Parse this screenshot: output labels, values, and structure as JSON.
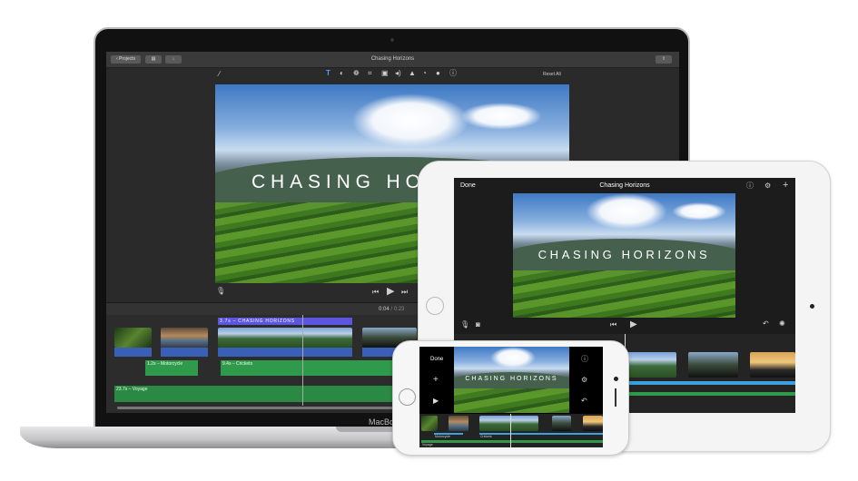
{
  "mac": {
    "brand": "MacBook",
    "toolbar": {
      "projects_label": "Projects",
      "title": "Chasing Horizons",
      "reset_label": "Reset All"
    },
    "tools": [
      "magic-wand-icon",
      "title-T-icon",
      "color-balance-icon",
      "color-correction-icon",
      "crop-icon",
      "stabilization-icon",
      "volume-icon",
      "noise-reduction-icon",
      "speed-icon",
      "filter-icon",
      "info-icon"
    ],
    "video_title": "CHASING HO",
    "time": {
      "current": "0:04",
      "total": "0:23"
    },
    "timeline": {
      "title_clip": "3.7s – CHASING HORIZONS",
      "audio": [
        "1.2s – Motorcycle",
        "9.4s – Crickets"
      ],
      "music": "23.7s – Voyage"
    }
  },
  "ipad": {
    "done_label": "Done",
    "title": "Chasing Horizons",
    "video_title": "CHASING HORIZONS"
  },
  "iphone": {
    "done_label": "Done",
    "video_title": "CHASING HORIZONS",
    "audio": [
      "Motorcycle",
      "Crickets"
    ],
    "music": "Voyage"
  },
  "colors": {
    "title_clip": "#5b55e0",
    "audio_clip": "#2f9a4c",
    "video_track": "#3a5fb6",
    "ios_audio": "#3aa0e0"
  }
}
